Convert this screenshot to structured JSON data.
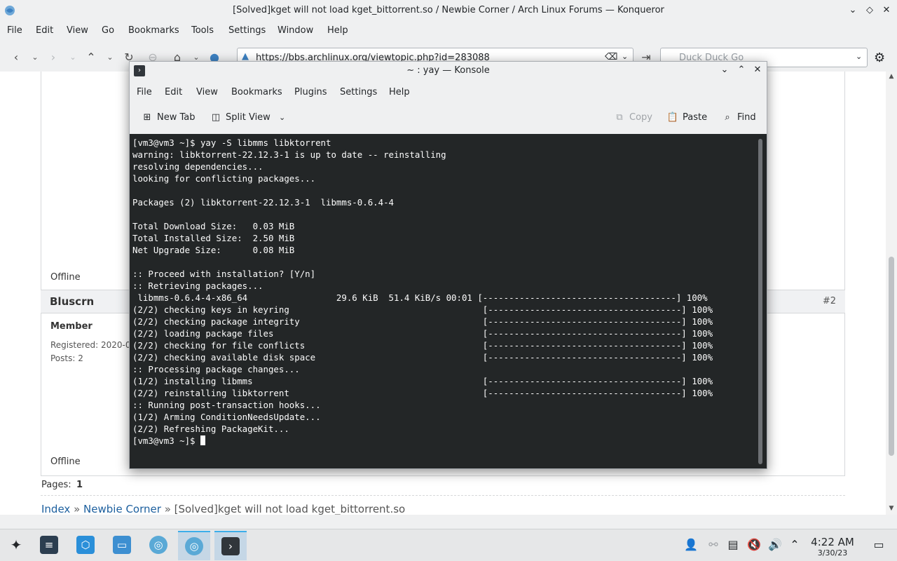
{
  "window": {
    "title": "[Solved]kget will not load kget_bittorrent.so / Newbie Corner / Arch Linux Forums — Konqueror"
  },
  "browser": {
    "menu": [
      "File",
      "Edit",
      "View",
      "Go",
      "Bookmarks",
      "Tools",
      "Settings",
      "Window",
      "Help"
    ],
    "url": "https://bbs.archlinux.org/viewtopic.php?id=283088",
    "search_placeholder": "Duck Duck Go"
  },
  "page": {
    "post1_status": "Offline",
    "post2": {
      "author": "Bluscrn",
      "number": "#2",
      "role": "Member",
      "registered": "Registered: 2020-02",
      "posts": "Posts: 2",
      "status": "Offline"
    },
    "pages_label": "Pages:",
    "pages_value": "1",
    "breadcrumb": {
      "index": "Index",
      "sep1": "»",
      "forum": "Newbie Corner",
      "sep2": "»",
      "topic": "[Solved]kget will not load kget_bittorrent.so"
    }
  },
  "konsole": {
    "title": "~ : yay — Konsole",
    "menu": [
      "File",
      "Edit",
      "View",
      "Bookmarks",
      "Plugins",
      "Settings",
      "Help"
    ],
    "toolbar": {
      "new_tab": "New Tab",
      "split_view": "Split View",
      "copy": "Copy",
      "paste": "Paste",
      "find": "Find"
    },
    "lines": [
      "[vm3@vm3 ~]$ yay -S libmms libktorrent",
      "warning: libktorrent-22.12.3-1 is up to date -- reinstalling",
      "resolving dependencies...",
      "looking for conflicting packages...",
      "",
      "Packages (2) libktorrent-22.12.3-1  libmms-0.6.4-4",
      "",
      "Total Download Size:   0.03 MiB",
      "Total Installed Size:  2.50 MiB",
      "Net Upgrade Size:      0.08 MiB",
      "",
      ":: Proceed with installation? [Y/n]",
      ":: Retrieving packages...",
      " libmms-0.6.4-4-x86_64                 29.6 KiB  51.4 KiB/s 00:01 [-------------------------------------] 100%",
      "(2/2) checking keys in keyring                                     [-------------------------------------] 100%",
      "(2/2) checking package integrity                                   [-------------------------------------] 100%",
      "(2/2) loading package files                                        [-------------------------------------] 100%",
      "(2/2) checking for file conflicts                                  [-------------------------------------] 100%",
      "(2/2) checking available disk space                                [-------------------------------------] 100%",
      ":: Processing package changes...",
      "(1/2) installing libmms                                            [-------------------------------------] 100%",
      "(2/2) reinstalling libktorrent                                     [-------------------------------------] 100%",
      ":: Running post-transaction hooks...",
      "(1/2) Arming ConditionNeedsUpdate...",
      "(2/2) Refreshing PackageKit...",
      "[vm3@vm3 ~]$ "
    ]
  },
  "taskbar": {
    "time": "4:22 AM",
    "date": "3/30/23",
    "launcher_icons": [
      "application-launcher-icon",
      "system-settings-icon",
      "discover-icon",
      "dolphin-icon",
      "browser-icon",
      "konqueror-icon",
      "konsole-icon"
    ],
    "tray_icons": [
      "user-icon",
      "network-icon",
      "clipboard-icon",
      "audio-muted-icon",
      "volume-icon",
      "expand-tray-icon"
    ]
  },
  "colors": {
    "accent": "#3daee9",
    "terminal_bg": "#232627",
    "link": "#1c5f9e"
  }
}
